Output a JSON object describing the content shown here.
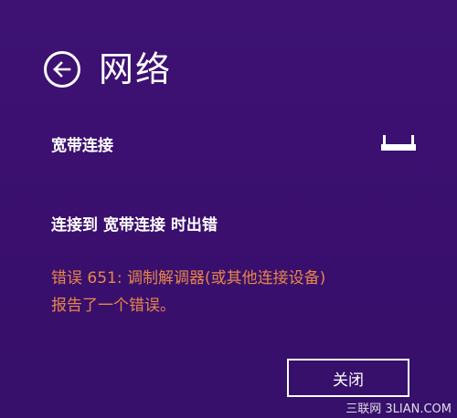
{
  "header": {
    "title": "网络",
    "back_icon": "back-arrow-circle-icon"
  },
  "connection": {
    "name": "宽带连接",
    "icon": "router-icon"
  },
  "error": {
    "heading": "连接到 宽带连接 时出错",
    "line1": "错误 651: 调制解调器(或其他连接设备)",
    "line2": "报告了一个错误。"
  },
  "actions": {
    "close_label": "关闭"
  },
  "watermark": "三联网 3LIAN.COM",
  "colors": {
    "background": "#3a0f6e",
    "error_text": "#e8864a",
    "text": "#ffffff"
  }
}
